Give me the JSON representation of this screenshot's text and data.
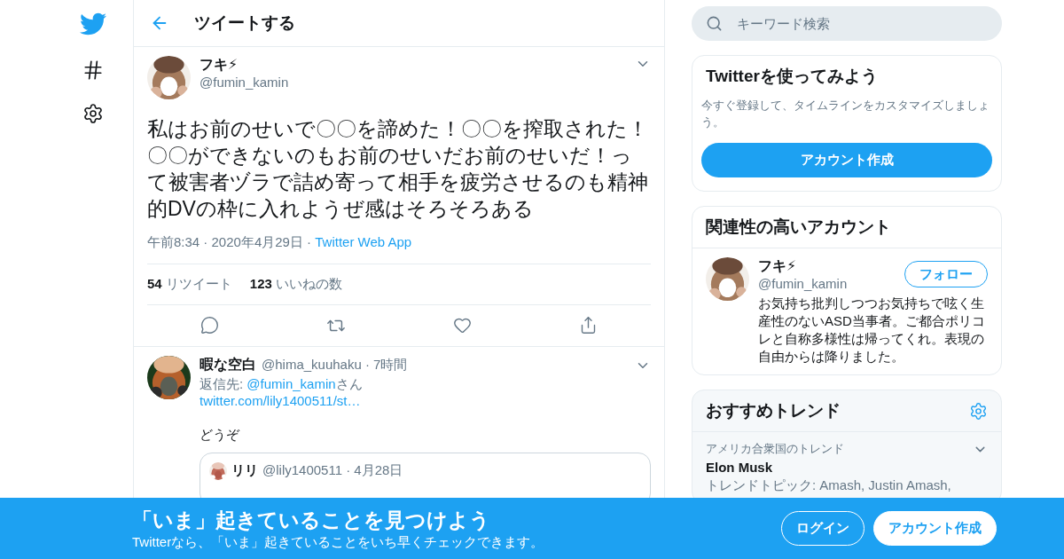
{
  "header": {
    "title": "ツイートする"
  },
  "tweet": {
    "name": "フキ⚡",
    "handle": "@fumin_kamin",
    "text": "私はお前のせいで〇〇を諦めた！〇〇を搾取された！〇〇ができないのもお前のせいだお前のせいだ！って被害者ヅラで詰め寄って相手を疲労させるのも精神的DVの枠に入れようぜ感はそろそろある",
    "time": "午前8:34 · 2020年4月29日 · ",
    "source": "Twitter Web App",
    "stats": [
      {
        "count": "54",
        "label": "リツイート"
      },
      {
        "count": "123",
        "label": "いいねの数"
      }
    ]
  },
  "replies": [
    {
      "name": "暇な空白",
      "meta": "@hima_kuuhaku · 7時間",
      "reply_prefix": "返信先: ",
      "reply_to": "@fumin_kamin",
      "reply_suffix": "さん",
      "link": "twitter.com/lily1400511/st…",
      "text": "どうぞ",
      "quote": {
        "name": "リリ",
        "meta": "@lily1400511 · 4月28日"
      }
    }
  ],
  "search": {
    "placeholder": "キーワード検索"
  },
  "signup_card": {
    "title": "Twitterを使ってみよう",
    "text": "今すぐ登録して、タイムラインをカスタマイズしましょう。",
    "button": "アカウント作成"
  },
  "related": {
    "title": "関連性の高いアカウント",
    "accounts": [
      {
        "name": "フキ⚡",
        "handle": "@fumin_kamin",
        "button": "フォロー",
        "bio": "お気持ち批判しつつお気持ちで呟く生産性のないASD当事者。ご都合ポリコレと自称多様性は帰ってくれ。表現の自由からは降りました。"
      }
    ]
  },
  "trends": {
    "title": "おすすめトレンド",
    "items": [
      {
        "context": "アメリカ合衆国のトレンド",
        "name": "Elon Musk",
        "detail": "トレンドトピック: Amash, Justin Amash,"
      }
    ]
  },
  "banner": {
    "title": "「いま」起きていることを見つけよう",
    "subtitle": "Twitterなら、「いま」起きていることをいち早くチェックできます。",
    "buttons": [
      {
        "label": "ログイン",
        "kind": "outline"
      },
      {
        "label": "アカウント作成",
        "kind": "filled"
      }
    ]
  }
}
